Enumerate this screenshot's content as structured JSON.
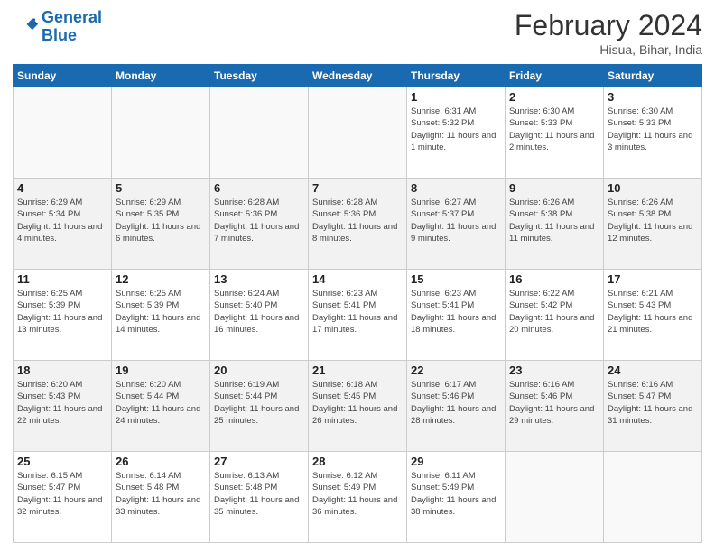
{
  "logo": {
    "line1": "General",
    "line2": "Blue"
  },
  "title": "February 2024",
  "location": "Hisua, Bihar, India",
  "days_header": [
    "Sunday",
    "Monday",
    "Tuesday",
    "Wednesday",
    "Thursday",
    "Friday",
    "Saturday"
  ],
  "weeks": [
    [
      {
        "num": "",
        "info": ""
      },
      {
        "num": "",
        "info": ""
      },
      {
        "num": "",
        "info": ""
      },
      {
        "num": "",
        "info": ""
      },
      {
        "num": "1",
        "info": "Sunrise: 6:31 AM\nSunset: 5:32 PM\nDaylight: 11 hours and 1 minute."
      },
      {
        "num": "2",
        "info": "Sunrise: 6:30 AM\nSunset: 5:33 PM\nDaylight: 11 hours and 2 minutes."
      },
      {
        "num": "3",
        "info": "Sunrise: 6:30 AM\nSunset: 5:33 PM\nDaylight: 11 hours and 3 minutes."
      }
    ],
    [
      {
        "num": "4",
        "info": "Sunrise: 6:29 AM\nSunset: 5:34 PM\nDaylight: 11 hours and 4 minutes."
      },
      {
        "num": "5",
        "info": "Sunrise: 6:29 AM\nSunset: 5:35 PM\nDaylight: 11 hours and 6 minutes."
      },
      {
        "num": "6",
        "info": "Sunrise: 6:28 AM\nSunset: 5:36 PM\nDaylight: 11 hours and 7 minutes."
      },
      {
        "num": "7",
        "info": "Sunrise: 6:28 AM\nSunset: 5:36 PM\nDaylight: 11 hours and 8 minutes."
      },
      {
        "num": "8",
        "info": "Sunrise: 6:27 AM\nSunset: 5:37 PM\nDaylight: 11 hours and 9 minutes."
      },
      {
        "num": "9",
        "info": "Sunrise: 6:26 AM\nSunset: 5:38 PM\nDaylight: 11 hours and 11 minutes."
      },
      {
        "num": "10",
        "info": "Sunrise: 6:26 AM\nSunset: 5:38 PM\nDaylight: 11 hours and 12 minutes."
      }
    ],
    [
      {
        "num": "11",
        "info": "Sunrise: 6:25 AM\nSunset: 5:39 PM\nDaylight: 11 hours and 13 minutes."
      },
      {
        "num": "12",
        "info": "Sunrise: 6:25 AM\nSunset: 5:39 PM\nDaylight: 11 hours and 14 minutes."
      },
      {
        "num": "13",
        "info": "Sunrise: 6:24 AM\nSunset: 5:40 PM\nDaylight: 11 hours and 16 minutes."
      },
      {
        "num": "14",
        "info": "Sunrise: 6:23 AM\nSunset: 5:41 PM\nDaylight: 11 hours and 17 minutes."
      },
      {
        "num": "15",
        "info": "Sunrise: 6:23 AM\nSunset: 5:41 PM\nDaylight: 11 hours and 18 minutes."
      },
      {
        "num": "16",
        "info": "Sunrise: 6:22 AM\nSunset: 5:42 PM\nDaylight: 11 hours and 20 minutes."
      },
      {
        "num": "17",
        "info": "Sunrise: 6:21 AM\nSunset: 5:43 PM\nDaylight: 11 hours and 21 minutes."
      }
    ],
    [
      {
        "num": "18",
        "info": "Sunrise: 6:20 AM\nSunset: 5:43 PM\nDaylight: 11 hours and 22 minutes."
      },
      {
        "num": "19",
        "info": "Sunrise: 6:20 AM\nSunset: 5:44 PM\nDaylight: 11 hours and 24 minutes."
      },
      {
        "num": "20",
        "info": "Sunrise: 6:19 AM\nSunset: 5:44 PM\nDaylight: 11 hours and 25 minutes."
      },
      {
        "num": "21",
        "info": "Sunrise: 6:18 AM\nSunset: 5:45 PM\nDaylight: 11 hours and 26 minutes."
      },
      {
        "num": "22",
        "info": "Sunrise: 6:17 AM\nSunset: 5:46 PM\nDaylight: 11 hours and 28 minutes."
      },
      {
        "num": "23",
        "info": "Sunrise: 6:16 AM\nSunset: 5:46 PM\nDaylight: 11 hours and 29 minutes."
      },
      {
        "num": "24",
        "info": "Sunrise: 6:16 AM\nSunset: 5:47 PM\nDaylight: 11 hours and 31 minutes."
      }
    ],
    [
      {
        "num": "25",
        "info": "Sunrise: 6:15 AM\nSunset: 5:47 PM\nDaylight: 11 hours and 32 minutes."
      },
      {
        "num": "26",
        "info": "Sunrise: 6:14 AM\nSunset: 5:48 PM\nDaylight: 11 hours and 33 minutes."
      },
      {
        "num": "27",
        "info": "Sunrise: 6:13 AM\nSunset: 5:48 PM\nDaylight: 11 hours and 35 minutes."
      },
      {
        "num": "28",
        "info": "Sunrise: 6:12 AM\nSunset: 5:49 PM\nDaylight: 11 hours and 36 minutes."
      },
      {
        "num": "29",
        "info": "Sunrise: 6:11 AM\nSunset: 5:49 PM\nDaylight: 11 hours and 38 minutes."
      },
      {
        "num": "",
        "info": ""
      },
      {
        "num": "",
        "info": ""
      }
    ]
  ]
}
